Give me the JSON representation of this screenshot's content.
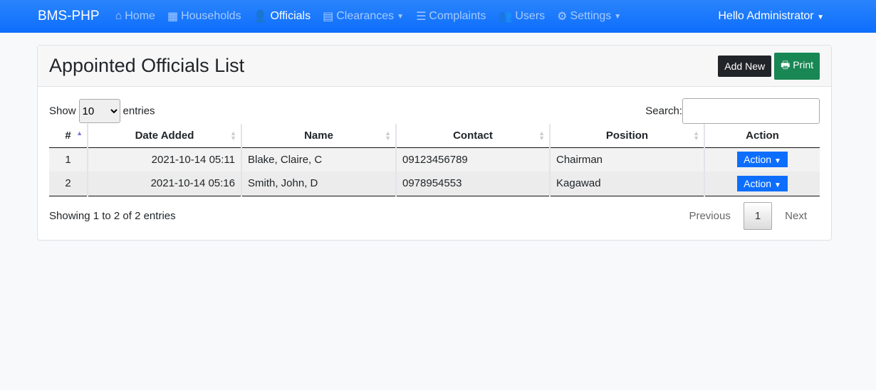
{
  "nav": {
    "brand": "BMS-PHP",
    "items": [
      {
        "label": "Home",
        "icon": "home-icon"
      },
      {
        "label": "Households",
        "icon": "table-icon"
      },
      {
        "label": "Officials",
        "icon": "user-tie-icon",
        "active": true
      },
      {
        "label": "Clearances",
        "icon": "file-icon",
        "dropdown": true
      },
      {
        "label": "Complaints",
        "icon": "list-icon"
      },
      {
        "label": "Users",
        "icon": "users-icon"
      },
      {
        "label": "Settings",
        "icon": "cogs-icon",
        "dropdown": true
      }
    ],
    "user": "Hello Administrator"
  },
  "card": {
    "title": "Appointed Officials List",
    "add_new": "Add New",
    "print": "Print"
  },
  "table": {
    "show": "Show",
    "entries_value": "10",
    "entries": "entries",
    "search": "Search:",
    "columns": [
      "#",
      "Date Added",
      "Name",
      "Contact",
      "Position",
      "Action"
    ],
    "rows": [
      {
        "n": "1",
        "date": "2021-10-14 05:11",
        "name": "Blake, Claire, C",
        "contact": "09123456789",
        "position": "Chairman",
        "action": "Action"
      },
      {
        "n": "2",
        "date": "2021-10-14 05:16",
        "name": "Smith, John, D",
        "contact": "0978954553",
        "position": "Kagawad",
        "action": "Action"
      }
    ],
    "info": "Showing 1 to 2 of 2 entries",
    "previous": "Previous",
    "page": "1",
    "next": "Next"
  }
}
